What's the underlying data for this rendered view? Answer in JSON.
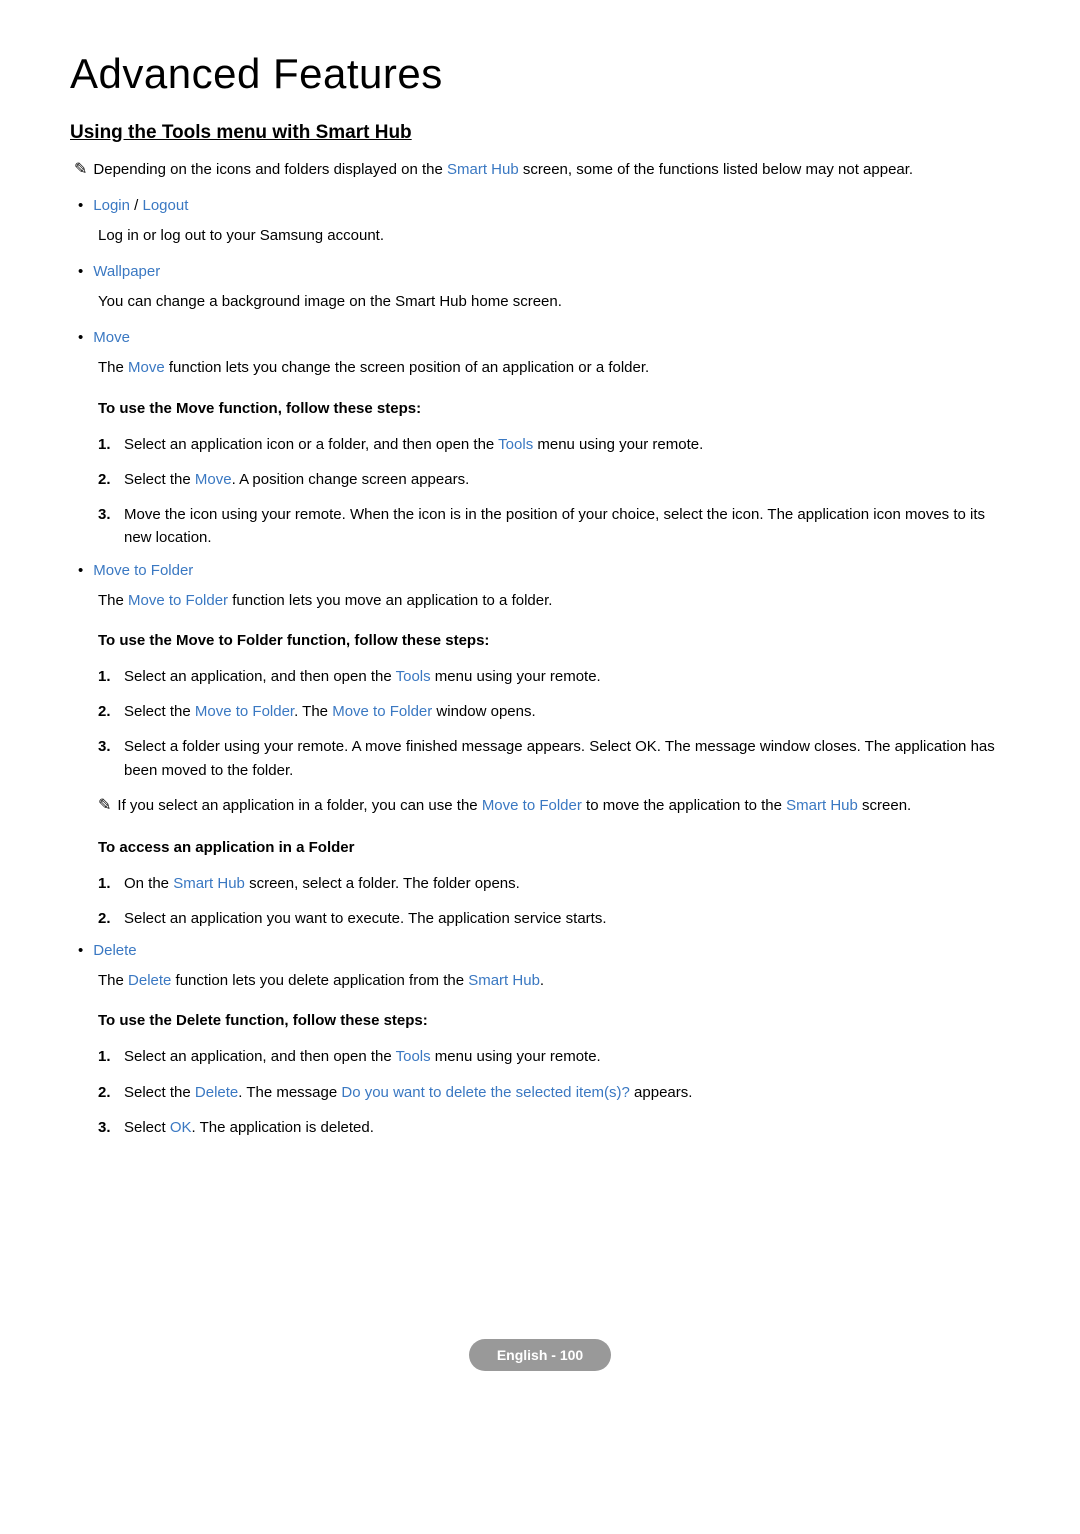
{
  "title": "Advanced Features",
  "section_title": "Using the Tools menu with Smart Hub",
  "top_note": {
    "pre": "Depending on the icons and folders displayed on the ",
    "smart_hub": "Smart Hub",
    "post": " screen, some of the functions listed below may not appear."
  },
  "login": {
    "login": "Login",
    "sep": " / ",
    "logout": "Logout",
    "desc": "Log in or log out to your Samsung account."
  },
  "wallpaper": {
    "label": "Wallpaper",
    "desc": "You can change a background image on the Smart Hub home screen."
  },
  "move": {
    "label": "Move",
    "desc_pre": "The ",
    "desc_blue": "Move",
    "desc_post": " function lets you change the screen position of an application or a folder.",
    "heading": "To use the Move function, follow these steps:",
    "steps": {
      "s1_pre": "Select an application icon or a folder, and then open the ",
      "s1_blue": "Tools",
      "s1_post": " menu using your remote.",
      "s2_pre": "Select the ",
      "s2_blue": "Move",
      "s2_post": ". A position change screen appears.",
      "s3": "Move the icon using your remote. When the icon is in the position of your choice, select the icon. The application icon moves to its new location."
    }
  },
  "mtf": {
    "label": "Move to Folder",
    "desc_pre": "The ",
    "desc_blue": "Move to Folder",
    "desc_post": " function lets you move an application to a folder.",
    "heading": "To use the Move to Folder function, follow these steps:",
    "steps": {
      "s1_pre": "Select an application, and then open the ",
      "s1_blue": "Tools",
      "s1_post": " menu using your remote.",
      "s2_pre": "Select the ",
      "s2_blue1": "Move to Folder",
      "s2_mid": ". The ",
      "s2_blue2": "Move to Folder",
      "s2_post": " window opens.",
      "s3": "Select a folder using your remote. A move finished message appears. Select OK. The message window closes. The application has been moved to the folder."
    },
    "note_pre": "If you select an application in a folder, you can use the ",
    "note_blue1": "Move to Folder",
    "note_mid": " to move the application to the ",
    "note_blue2": "Smart Hub",
    "note_post": " screen.",
    "access_heading": "To access an application in a Folder",
    "access_steps": {
      "s1_pre": "On the ",
      "s1_blue": "Smart Hub",
      "s1_post": " screen, select a folder. The folder opens.",
      "s2": "Select an application you want to execute. The application service starts."
    }
  },
  "delete": {
    "label": "Delete",
    "desc_pre": "The ",
    "desc_blue1": "Delete",
    "desc_mid": " function lets you delete application from the ",
    "desc_blue2": "Smart Hub",
    "desc_post": ".",
    "heading": "To use the Delete function, follow these steps:",
    "steps": {
      "s1_pre": "Select an application, and then open the ",
      "s1_blue": "Tools",
      "s1_post": " menu using your remote.",
      "s2_pre": "Select the ",
      "s2_blue1": "Delete",
      "s2_mid": ". The message ",
      "s2_blue2": "Do you want to delete the selected item(s)?",
      "s2_post": " appears.",
      "s3_pre": "Select ",
      "s3_blue": "OK",
      "s3_post": ". The application is deleted."
    }
  },
  "nums": {
    "n1": "1.",
    "n2": "2.",
    "n3": "3."
  },
  "footer": "English - 100",
  "note_glyph": "✎"
}
